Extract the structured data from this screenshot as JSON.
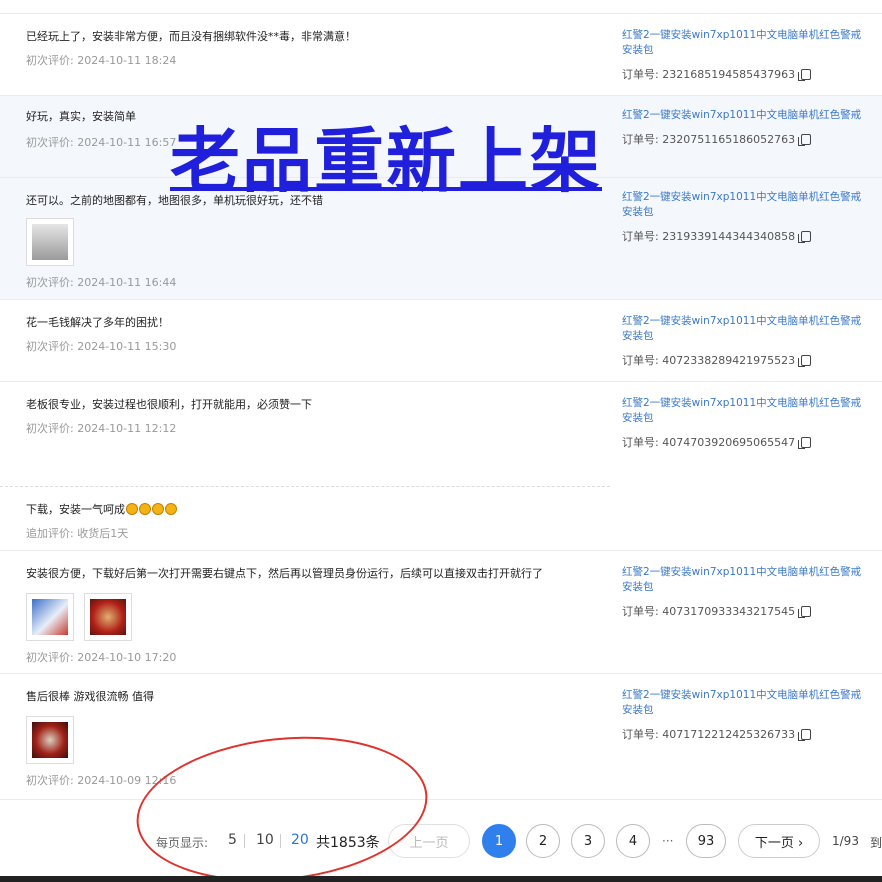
{
  "overlay_text": "老品重新上架",
  "reviews": [
    {
      "comment": "已经玩上了，安装非常方便，而且没有捆绑软件没**毒，非常满意！",
      "date": "初次评价: 2024-10-11 18:24",
      "product_line1": "红警2一键安装win7xp1011中文电脑单机红色警戒",
      "product_line2": "安装包",
      "order": "订单号: 2321685194585437963"
    },
    {
      "comment": "好玩，真实，安装简单",
      "date": "初次评价: 2024-10-11 16:57",
      "product_line1": "红警2一键安装win7xp1011中文电脑单机红色警戒",
      "product_line2": "",
      "order": "订单号: 2320751165186052763"
    },
    {
      "comment": "还可以。之前的地图都有，地图很多，单机玩很好玩，还不错",
      "date": "初次评价: 2024-10-11 16:44",
      "product_line1": "红警2一键安装win7xp1011中文电脑单机红色警戒",
      "product_line2": "安装包",
      "order": "订单号: 2319339144344340858"
    },
    {
      "comment": "花一毛钱解决了多年的困扰！",
      "date": "初次评价: 2024-10-11 15:30",
      "product_line1": "红警2一键安装win7xp1011中文电脑单机红色警戒",
      "product_line2": "安装包",
      "order": "订单号: 4072338289421975523"
    },
    {
      "comment": "老板很专业，安装过程也很顺利，打开就能用，必须赞一下",
      "date": "初次评价: 2024-10-11 12:12",
      "product_line1": "红警2一键安装win7xp1011中文电脑单机红色警戒",
      "product_line2": "安装包",
      "order": "订单号: 4074703920695065547"
    },
    {
      "comment": "安装很方便，下载好后第一次打开需要右键点下，然后再以管理员身份运行，后续可以直接双击打开就行了",
      "date": "初次评价: 2024-10-10 17:20",
      "product_line1": "红警2一键安装win7xp1011中文电脑单机红色警戒",
      "product_line2": "安装包",
      "order": "订单号: 4073170933343217545"
    },
    {
      "comment": "售后很棒 游戏很流畅 值得",
      "date": "初次评价: 2024-10-09 12:16",
      "product_line1": "红警2一键安装win7xp1011中文电脑单机红色警戒",
      "product_line2": "安装包",
      "order": "订单号: 4071712212425326733"
    }
  ],
  "followup": {
    "text": "下载，安装一气呵成",
    "meta": "追加评价: 收货后1天"
  },
  "pager": {
    "per_page_label": "每页显示:",
    "sizes": [
      "5",
      "10",
      "20"
    ],
    "active_size": "20",
    "total": "共1853条",
    "prev": "上一页",
    "pages": [
      "1",
      "2",
      "3",
      "4"
    ],
    "ellipsis": "···",
    "last_page": "93",
    "next": "下一页 ›",
    "info": "1/93",
    "goto": "到"
  },
  "colors": {
    "accent": "#2f80ed",
    "link": "#3a78c9",
    "overlay": "#1f1fdc",
    "circle": "#e0322c"
  }
}
